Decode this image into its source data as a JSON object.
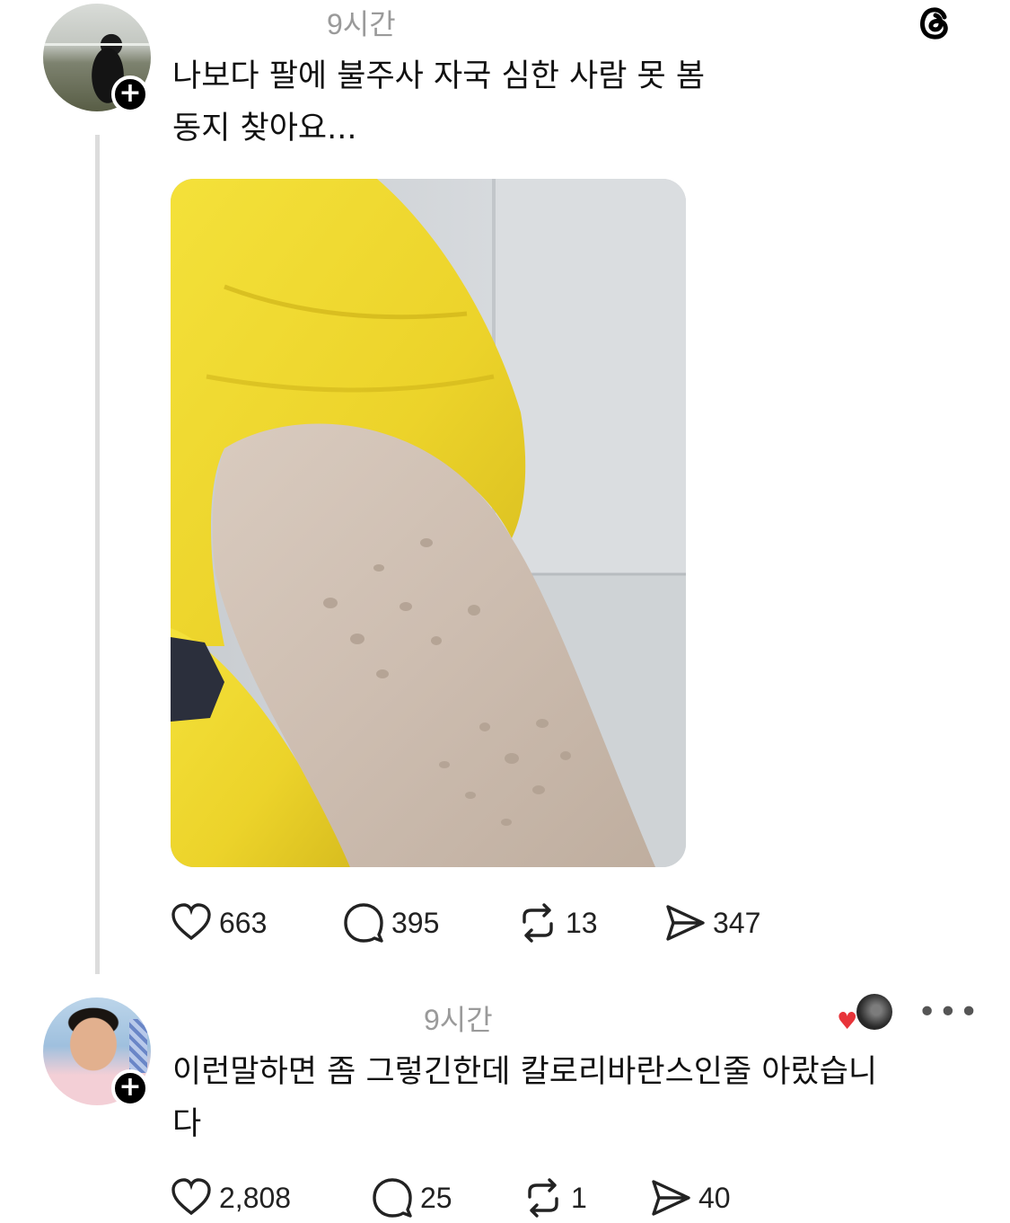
{
  "post": {
    "time": "9시간",
    "text": "나보다 팔에 불주사 자국 심한 사람 못 봄\n동지 찾아요...",
    "stats": {
      "likes": "663",
      "comments": "395",
      "reposts": "13",
      "shares": "347"
    }
  },
  "reply": {
    "time": "9시간",
    "text": "이런말하면 좀 그렇긴한데 칼로리바란스인줄 아랐습니\n다",
    "stats": {
      "likes": "2,808",
      "comments": "25",
      "reposts": "1",
      "shares": "40"
    }
  },
  "icons": {
    "app_logo": "threads-logo-icon",
    "like": "heart-icon",
    "comment": "comment-bubble-icon",
    "repost": "repost-icon",
    "share": "send-icon",
    "follow": "plus-icon",
    "more": "more-dots-icon"
  },
  "colors": {
    "shirt": "#f2dc2f",
    "liked_heart": "#e8343a",
    "muted_text": "#9a9a9a"
  }
}
